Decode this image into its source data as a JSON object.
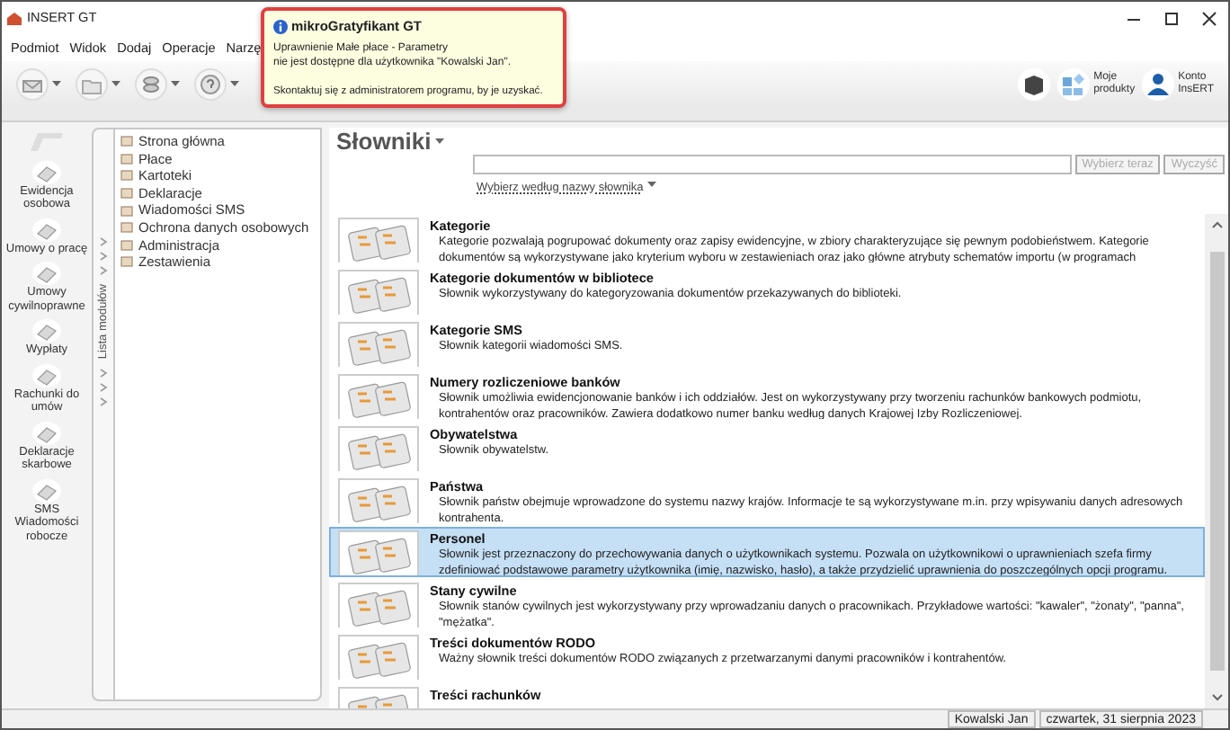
{
  "window": {
    "title": "INSERT GT"
  },
  "menu": [
    {
      "label": "Podmiot"
    },
    {
      "label": "Widok"
    },
    {
      "label": "Dodaj"
    },
    {
      "label": "Operacje"
    },
    {
      "label": "Narzę"
    }
  ],
  "tooltip": {
    "title": "mikroGratyfikant GT",
    "message": "Uprawnienie Małe płace - Parametry\nnie jest dostępne dla użytkownika \"Kowalski Jan\".",
    "hint": "Skontaktuj się z administratorem programu, by je uzyskać."
  },
  "toolbar_buttons": [
    {
      "kind": "envelope"
    },
    {
      "kind": "folder"
    },
    {
      "kind": "coins"
    },
    {
      "kind": "help"
    }
  ],
  "account_buttons": [
    {
      "kind": "cube"
    },
    {
      "kind": "products",
      "label": "Moje\nprodukty"
    },
    {
      "kind": "account",
      "label": "Konto\nInsERT"
    }
  ],
  "modules": [
    {
      "label": "Ewidencja\nosobowa"
    },
    {
      "label": "Umowy o pracę"
    },
    {
      "label": "Umowy\ncywilnoprawne"
    },
    {
      "label": "Wypłaty"
    },
    {
      "label": "Rachunki do\numów"
    },
    {
      "label": "Deklaracje\nskarbowe"
    },
    {
      "label": "SMS\nWiadomości\nrobocze"
    }
  ],
  "module_list_label": "Lista modułów",
  "nav": [
    {
      "label": "Strona główna"
    },
    {
      "label": "Płace"
    },
    {
      "label": "Kartoteki"
    },
    {
      "label": "Deklaracje"
    },
    {
      "label": "Wiadomości SMS"
    },
    {
      "label": "Ochrona danych osobowych"
    },
    {
      "label": "Administracja"
    },
    {
      "label": "Zestawienia"
    }
  ],
  "page": {
    "title": "Słowniki",
    "search_mode": "Wybierz według nazwy słownika",
    "buttons": [
      {
        "label": "Wybierz teraz",
        "disabled": true
      },
      {
        "label": "Wyczyść",
        "disabled": true
      }
    ]
  },
  "dictionaries": [
    {
      "title": "Kategorie",
      "description": "Kategorie pozwalają pogrupować dokumenty oraz zapisy ewidencyjne, w zbiory charakteryzujące się pewnym podobieństwem. Kategorie dokumentów są wykorzystywane jako kryterium wyboru w zestawieniach oraz jako główne atrybuty schematów importu (w programach",
      "selected": false
    },
    {
      "title": "Kategorie dokumentów w bibliotece",
      "description": "Słownik wykorzystywany do kategoryzowania dokumentów przekazywanych do biblioteki.",
      "selected": false
    },
    {
      "title": "Kategorie SMS",
      "description": "Słownik kategorii wiadomości SMS.",
      "selected": false
    },
    {
      "title": "Numery rozliczeniowe banków",
      "description": "Słownik umożliwia ewidencjonowanie banków i ich oddziałów. Jest on wykorzystywany przy tworzeniu rachunków bankowych podmiotu, kontrahentów oraz pracowników. Zawiera dodatkowo numer banku według danych Krajowej Izby Rozliczeniowej.",
      "selected": false
    },
    {
      "title": "Obywatelstwa",
      "description": "Słownik obywatelstw.",
      "selected": false
    },
    {
      "title": "Państwa",
      "description": "Słownik państw obejmuje wprowadzone do systemu nazwy krajów. Informacje te są wykorzystywane m.in. przy wpisywaniu danych adresowych kontrahenta.",
      "selected": false
    },
    {
      "title": "Personel",
      "description": "Słownik jest przeznaczony do przechowywania danych o użytkownikach systemu. Pozwala on użytkownikowi o uprawnieniach szefa firmy zdefiniować podstawowe parametry użytkownika (imię, nazwisko, hasło), a także przydzielić uprawnienia do poszczególnych opcji programu.",
      "selected": true
    },
    {
      "title": "Stany cywilne",
      "description": "Słownik stanów cywilnych jest wykorzystywany przy wprowadzaniu danych o pracownikach. Przykładowe wartości: \"kawaler\", \"żonaty\", \"panna\", \"mężatka\".",
      "selected": false
    },
    {
      "title": "Treści dokumentów RODO",
      "description": "Ważny słownik treści dokumentów RODO związanych z przetwarzanymi danymi pracowników i kontrahentów.",
      "selected": false
    },
    {
      "title": "Treści rachunków",
      "selected": false
    }
  ],
  "status_bar": [
    {
      "text": "Kowalski Jan"
    },
    {
      "text": "czwartek, 31 sierpnia 2023"
    }
  ]
}
